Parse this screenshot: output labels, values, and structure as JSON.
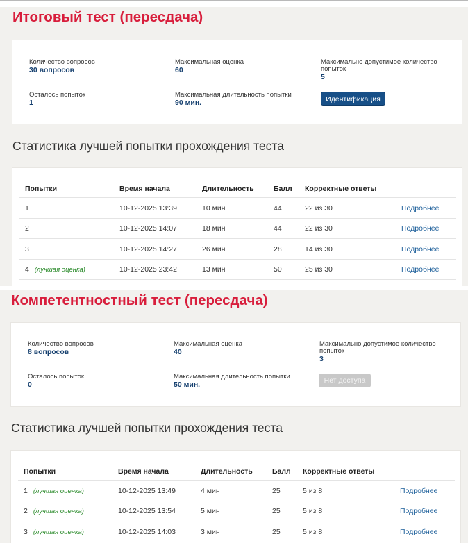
{
  "tests": [
    {
      "title": "Итоговый тест (пересдача)",
      "info": {
        "questions_label": "Количество вопросов",
        "questions_value": "30 вопросов",
        "max_score_label": "Максимальная оценка",
        "max_score_value": "60",
        "max_attempts_label_1": "Максимально допустимое количество",
        "max_attempts_label_2": "попыток",
        "max_attempts_value": "5",
        "attempts_left_label": "Осталось попыток",
        "attempts_left_value": "1",
        "max_duration_label": "Максимальная длительность попытки",
        "max_duration_value": "90 мин.",
        "button_label": "Идентификация"
      },
      "stats_title": "Статистика лучшей попытки прохождения теста",
      "columns": [
        "Попытки",
        "Время начала",
        "Длительность",
        "Балл",
        "Корректные ответы"
      ],
      "rows": [
        {
          "attempt": "1",
          "best": "",
          "start": "10-12-2025 13:39",
          "duration": "10 мин",
          "score": "44",
          "correct": "22 из 30",
          "link": "Подробнее"
        },
        {
          "attempt": "2",
          "best": "",
          "start": "10-12-2025 14:07",
          "duration": "18 мин",
          "score": "44",
          "correct": "22 из 30",
          "link": "Подробнее"
        },
        {
          "attempt": "3",
          "best": "",
          "start": "10-12-2025 14:27",
          "duration": "26 мин",
          "score": "28",
          "correct": "14 из 30",
          "link": "Подробнее"
        },
        {
          "attempt": "4",
          "best": "(лучшая оценка)",
          "start": "10-12-2025 23:42",
          "duration": "13 мин",
          "score": "50",
          "correct": "25 из 30",
          "link": "Подробнее"
        }
      ]
    },
    {
      "title": "Компетентностный тест (пересдача)",
      "info": {
        "questions_label": "Количество вопросов",
        "questions_value": "8 вопросов",
        "max_score_label": "Максимальная оценка",
        "max_score_value": "40",
        "max_attempts_label_1": "Максимально допустимое количество",
        "max_attempts_label_2": "попыток",
        "max_attempts_value": "3",
        "attempts_left_label": "Осталось попыток",
        "attempts_left_value": "0",
        "max_duration_label": "Максимальная длительность попытки",
        "max_duration_value": "50 мин.",
        "button_label": "Нет доступа"
      },
      "stats_title": "Статистика лучшей попытки прохождения теста",
      "columns": [
        "Попытки",
        "Время начала",
        "Длительность",
        "Балл",
        "Корректные ответы"
      ],
      "rows": [
        {
          "attempt": "1",
          "best": "(лучшая оценка)",
          "start": "10-12-2025 13:49",
          "duration": "4 мин",
          "score": "25",
          "correct": "5 из 8",
          "link": "Подробнее"
        },
        {
          "attempt": "2",
          "best": "(лучшая оценка)",
          "start": "10-12-2025 13:54",
          "duration": "5 мин",
          "score": "25",
          "correct": "5 из 8",
          "link": "Подробнее"
        },
        {
          "attempt": "3",
          "best": "(лучшая оценка)",
          "start": "10-12-2025 14:03",
          "duration": "3 мин",
          "score": "25",
          "correct": "5 из 8",
          "link": "Подробнее"
        }
      ]
    }
  ]
}
